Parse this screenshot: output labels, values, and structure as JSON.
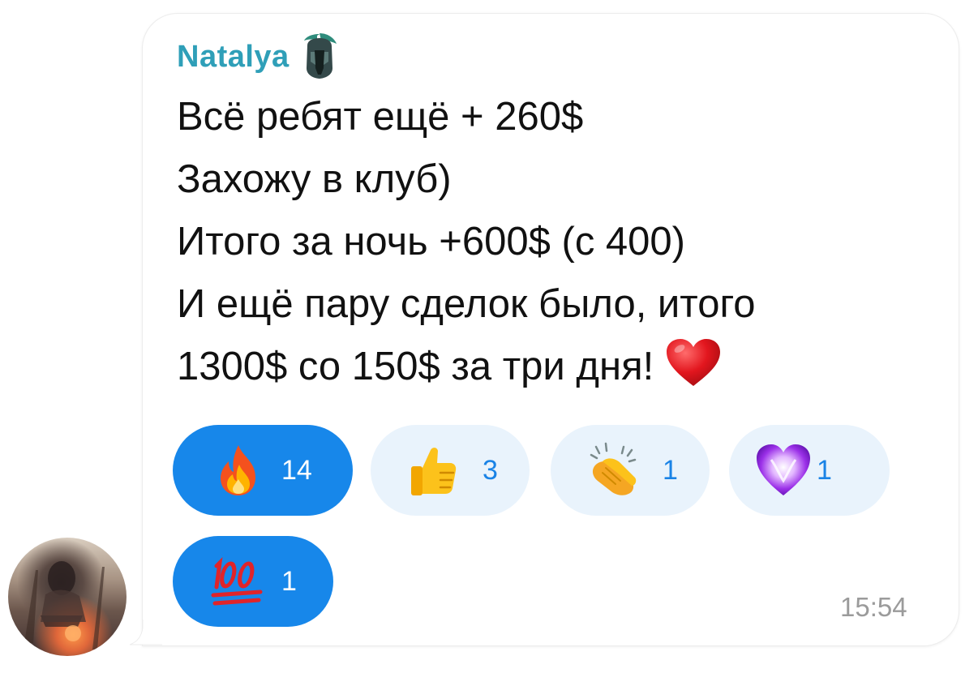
{
  "message": {
    "author": "Natalya",
    "author_badge_icon": "spartan-helmet-icon",
    "lines": [
      "Всё ребят ещё + 260$",
      "Захожу в клуб)",
      "Итого за ночь +600$ (с 400)",
      "И ещё пару сделок было, итого",
      "1300$ со 150$ за три дня!"
    ],
    "trailing_emoji": "red-heart-emoji",
    "time": "15:54"
  },
  "reactions": [
    {
      "emoji": "fire-emoji",
      "count": "14",
      "selected": true
    },
    {
      "emoji": "thumbs-up-emoji",
      "count": "3",
      "selected": false
    },
    {
      "emoji": "clapping-hands-emoji",
      "count": "1",
      "selected": false
    },
    {
      "emoji": "purple-heart-emoji",
      "count": "1",
      "selected": false
    },
    {
      "emoji": "hundred-points-emoji",
      "count": "1",
      "selected": true
    }
  ],
  "colors": {
    "author": "#2f9fb8",
    "reaction_selected_bg": "#1787ea",
    "reaction_unselected_bg": "#e9f3fc",
    "reaction_unselected_text": "#1a83e6",
    "time": "#9b9b9b"
  }
}
